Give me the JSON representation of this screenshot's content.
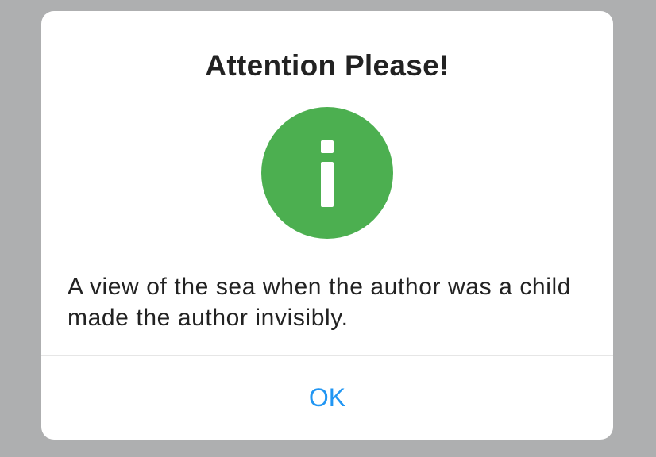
{
  "dialog": {
    "title": "Attention Please!",
    "icon": "info-icon",
    "icon_color": "#4caf50",
    "message": "A view of the sea when the author was a child made the author invisibly.",
    "ok_label": "OK",
    "ok_color": "#2196f3"
  }
}
